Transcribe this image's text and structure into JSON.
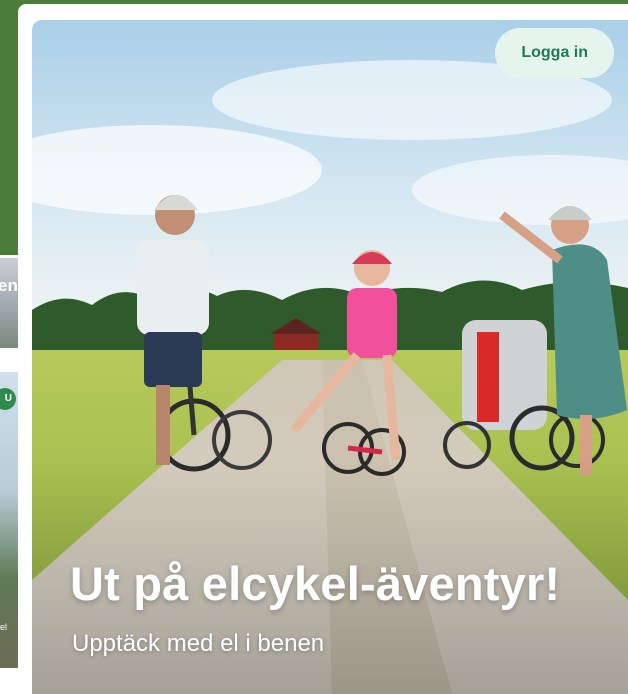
{
  "background_page": {
    "card_1_partial_text": "en",
    "card_2_badge_partial": "U",
    "card_2_label_partial": "el"
  },
  "header": {
    "login_label": "Logga in"
  },
  "hero": {
    "title": "Ut på elcykel-äventyr!",
    "subtitle": "Upptäck med el i benen",
    "image_icon": "family-cycling-photo"
  },
  "colors": {
    "background_green": "#4b7d3a",
    "login_bg": "#e6f4ee",
    "login_text": "#1f7a55",
    "hero_text": "#ffffff"
  }
}
